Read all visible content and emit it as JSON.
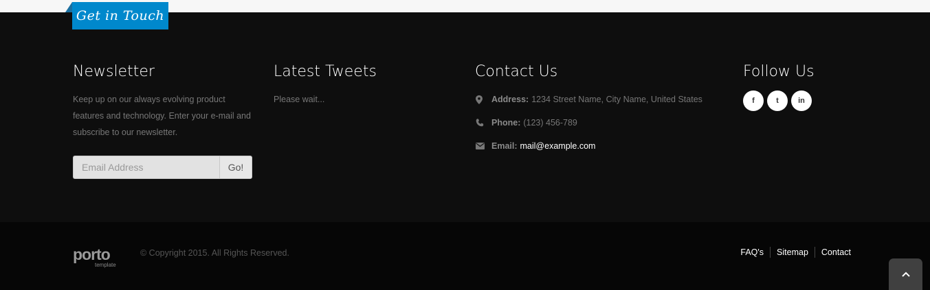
{
  "ribbon": {
    "label": "Get in Touch"
  },
  "newsletter": {
    "title": "Newsletter",
    "text": "Keep up on our always evolving product features and technology. Enter your e-mail and subscribe to our newsletter.",
    "email_placeholder": "Email Address",
    "submit_label": "Go!"
  },
  "tweets": {
    "title": "Latest Tweets",
    "text": "Please wait..."
  },
  "contact": {
    "title": "Contact Us",
    "items": [
      {
        "icon": "map-marker-icon",
        "label": "Address:",
        "value": "1234 Street Name, City Name, United States"
      },
      {
        "icon": "phone-icon",
        "label": "Phone:",
        "value": "(123) 456-789"
      },
      {
        "icon": "envelope-icon",
        "label": "Email:",
        "value": "mail@example.com"
      }
    ]
  },
  "follow": {
    "title": "Follow Us",
    "networks": [
      {
        "icon": "facebook-icon",
        "glyph": "f"
      },
      {
        "icon": "twitter-icon",
        "glyph": "t"
      },
      {
        "icon": "linkedin-icon",
        "glyph": "in"
      }
    ]
  },
  "bottom": {
    "logo_word": "porto",
    "logo_sub": "template",
    "copyright": "© Copyright 2015. All Rights Reserved.",
    "links": [
      "FAQ's",
      "Sitemap",
      "Contact"
    ],
    "scroll_top_icon": "chevron-up-icon"
  },
  "colors": {
    "accent": "#0088cc",
    "footer_bg": "#0e0e0e",
    "footer_bottom_bg": "#060606",
    "muted_text": "#777777"
  }
}
